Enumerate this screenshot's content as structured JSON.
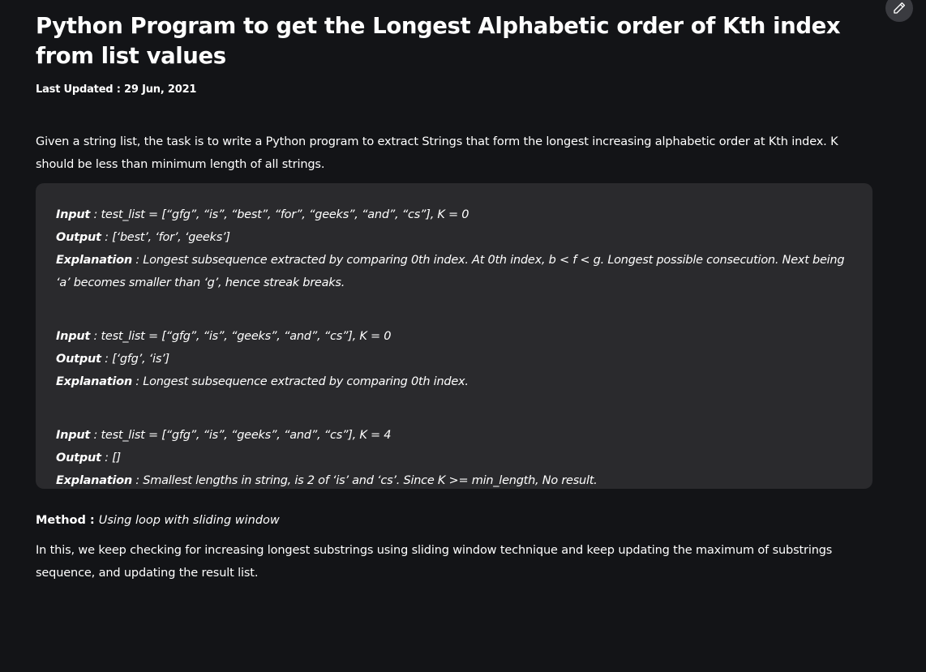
{
  "article": {
    "title": "Python Program to get the Longest Alphabetic order of Kth index from list values",
    "last_updated": "Last Updated : 29 Jun, 2021",
    "intro": "Given a string list, the task is to write a Python program to extract Strings that form the longest increasing alphabetic order at Kth index. K should be less than minimum length of all strings.",
    "labels": {
      "input": "Input",
      "output": "Output",
      "explanation": "Explanation"
    },
    "examples": [
      {
        "input": " : test_list = [“gfg”, “is”, “best”, “for”, “geeks”, “and”, “cs”], K = 0",
        "output": " : [‘best’, ‘for’, ‘geeks’]",
        "explanation": " : Longest subsequence extracted by comparing 0th index. At 0th index, b < f < g. Longest possible consecution. Next being ‘a’ becomes smaller than ‘g’, hence streak breaks."
      },
      {
        "input": " : test_list = [“gfg”, “is”, “geeks”, “and”, “cs”], K = 0",
        "output": " : [‘gfg’, ‘is’]",
        "explanation": " : Longest subsequence extracted by comparing 0th index."
      },
      {
        "input": " : test_list = [“gfg”, “is”, “geeks”, “and”, “cs”], K = 4",
        "output": " : []",
        "explanation": " : Smallest lengths in string, is 2 of ‘is’ and ‘cs’. Since K >= min_length, No result."
      }
    ],
    "method_label": "Method : ",
    "method_value": "Using loop with sliding window",
    "method_description": "In this, we keep checking for increasing longest substrings using sliding window technique and keep updating the maximum of substrings sequence, and updating the result list."
  },
  "toolbar": {
    "edit_icon": "pencil-icon"
  },
  "colors": {
    "background": "#131417",
    "code_box": "#2a2a2d",
    "text": "#ffffff"
  }
}
